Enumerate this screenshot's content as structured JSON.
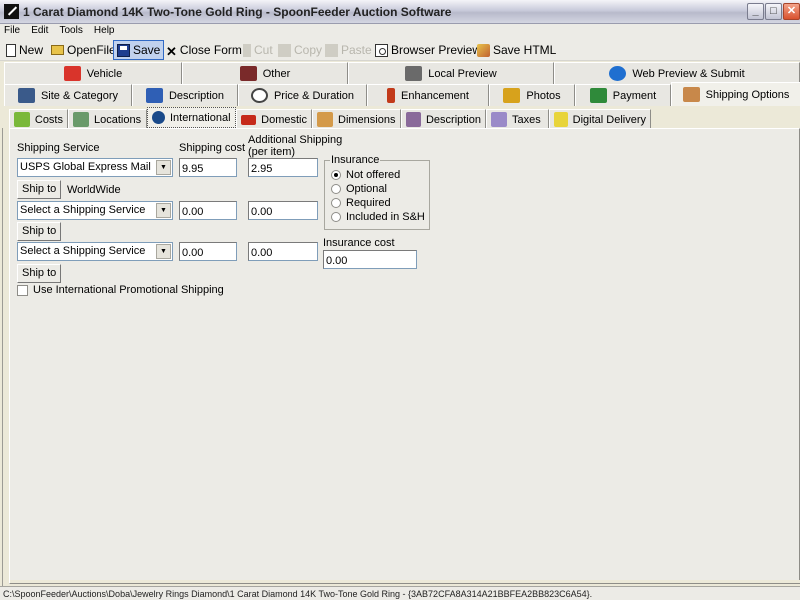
{
  "window": {
    "title": "1 Carat Diamond 14K Two-Tone Gold Ring - SpoonFeeder Auction Software",
    "controls": {
      "minimize": "_",
      "maximize": "□",
      "close": "✕"
    }
  },
  "menu": [
    "File",
    "Edit",
    "Tools",
    "Help"
  ],
  "toolbar": {
    "new": "New",
    "open_file": "OpenFile",
    "save": "Save",
    "close_form": "Close Form",
    "cut": "Cut",
    "copy": "Copy",
    "paste": "Paste",
    "browser_preview": "Browser Preview",
    "save_html": "Save HTML"
  },
  "tabs_row1": [
    {
      "label": "Vehicle",
      "icon": "car-icon",
      "color": "#d9342b"
    },
    {
      "label": "Other",
      "icon": "barcode-icon",
      "color": "#7a2a2a"
    },
    {
      "label": "Local Preview",
      "icon": "monitor-icon",
      "color": "#6a6a6a"
    },
    {
      "label": "Web Preview & Submit",
      "icon": "globe-icon",
      "color": "#1f6fd0"
    }
  ],
  "tabs_row2": [
    {
      "label": "Site & Category",
      "icon": "tree-icon",
      "color": "#3a5a8a"
    },
    {
      "label": "Description",
      "icon": "edit-document-icon",
      "color": "#2f5fb5"
    },
    {
      "label": "Price & Duration",
      "icon": "clock-icon",
      "color": "#444444"
    },
    {
      "label": "Enhancement",
      "icon": "magic-wand-icon",
      "color": "#c23a1a"
    },
    {
      "label": "Photos",
      "icon": "film-icon",
      "color": "#d7a21c"
    },
    {
      "label": "Payment",
      "icon": "cash-register-icon",
      "color": "#2f8a3a"
    },
    {
      "label": "Shipping Options",
      "icon": "package-icon",
      "color": "#c8884a",
      "active": true
    }
  ],
  "subtabs": [
    {
      "label": "Costs",
      "icon": "money-icon",
      "color": "#7ab83a"
    },
    {
      "label": "Locations",
      "icon": "building-icon",
      "color": "#6a9a6a"
    },
    {
      "label": "International",
      "icon": "globe-icon",
      "color": "#1a4a8a",
      "active": true
    },
    {
      "label": "Domestic",
      "icon": "house-icon",
      "color": "#c62a1a"
    },
    {
      "label": "Dimensions",
      "icon": "box-icon",
      "color": "#d49a4a"
    },
    {
      "label": "Description",
      "icon": "mailbox-icon",
      "color": "#8a6a9a"
    },
    {
      "label": "Taxes",
      "icon": "calculator-icon",
      "color": "#9a8ac8"
    },
    {
      "label": "Digital Delivery",
      "icon": "digital-delivery-icon",
      "color": "#e8d43a"
    }
  ],
  "form": {
    "headers": {
      "service": "Shipping Service",
      "cost": "Shipping cost",
      "additional": "Additional Shipping",
      "additional_sub": "(per item)"
    },
    "rows": [
      {
        "service": "USPS Global Express Mail",
        "cost": "9.95",
        "additional": "2.95",
        "ship_to_label": "Ship to",
        "ship_to_value": "WorldWide"
      },
      {
        "service": "Select a Shipping Service",
        "cost": "0.00",
        "additional": "0.00",
        "ship_to_label": "Ship to",
        "ship_to_value": ""
      },
      {
        "service": "Select a Shipping Service",
        "cost": "0.00",
        "additional": "0.00",
        "ship_to_label": "Ship to",
        "ship_to_value": ""
      }
    ],
    "insurance": {
      "legend": "Insurance",
      "options": [
        "Not offered",
        "Optional",
        "Required",
        "Included in S&H"
      ],
      "selected": "Not offered"
    },
    "insurance_cost_label": "Insurance cost",
    "insurance_cost": "0.00",
    "promo_label": "Use International Promotional Shipping",
    "promo_checked": false
  },
  "statusbar": "C:\\SpoonFeeder\\Auctions\\Doba\\Jewelry Rings Diamond\\1 Carat Diamond 14K Two-Tone Gold Ring - {3AB72CFA8A314A21BBFEA2BB823C6A54}."
}
